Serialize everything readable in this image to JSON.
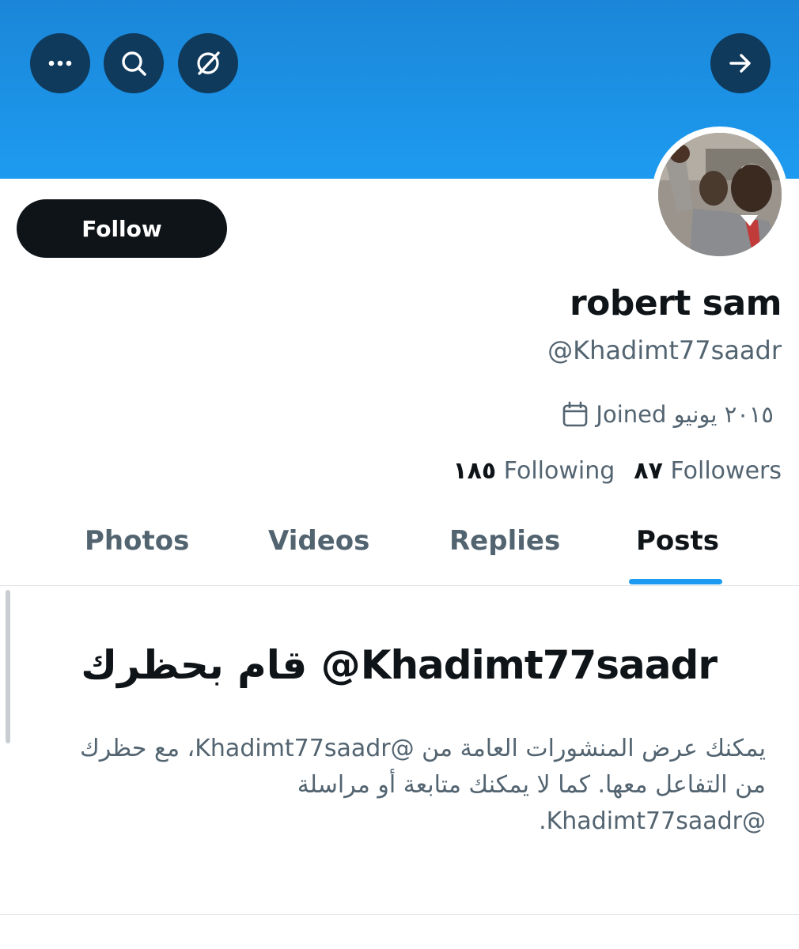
{
  "profile": {
    "name": "robert sam",
    "handle": "@Khadimt77saadr",
    "joined": "Joined ٢٠١٥ يونيو",
    "follow_label": "Follow",
    "following_count": "١٨٥",
    "following_label": "Following",
    "followers_count": "٨٧",
    "followers_label": "Followers"
  },
  "header": {
    "icons": [
      "more-icon",
      "search-icon",
      "grok-icon",
      "forward-arrow-icon"
    ]
  },
  "tabs": [
    {
      "label": "Photos"
    },
    {
      "label": "Videos"
    },
    {
      "label": "Replies"
    },
    {
      "label": "Posts",
      "active": true
    }
  ],
  "blocked": {
    "title": "قام بحظرك @Khadimt77saadr",
    "body": "يمكنك عرض المنشورات العامة من @Khadimt77saadr، مع حظرك من التفاعل معها. كما لا يمكنك متابعة أو مراسلة @Khadimt77saadr."
  },
  "colors": {
    "banner": "#1d9bf0",
    "button_dark": "#0f3a5c",
    "follow_button": "#0f1419",
    "accent": "#1d9bf0",
    "muted_text": "#536471"
  }
}
